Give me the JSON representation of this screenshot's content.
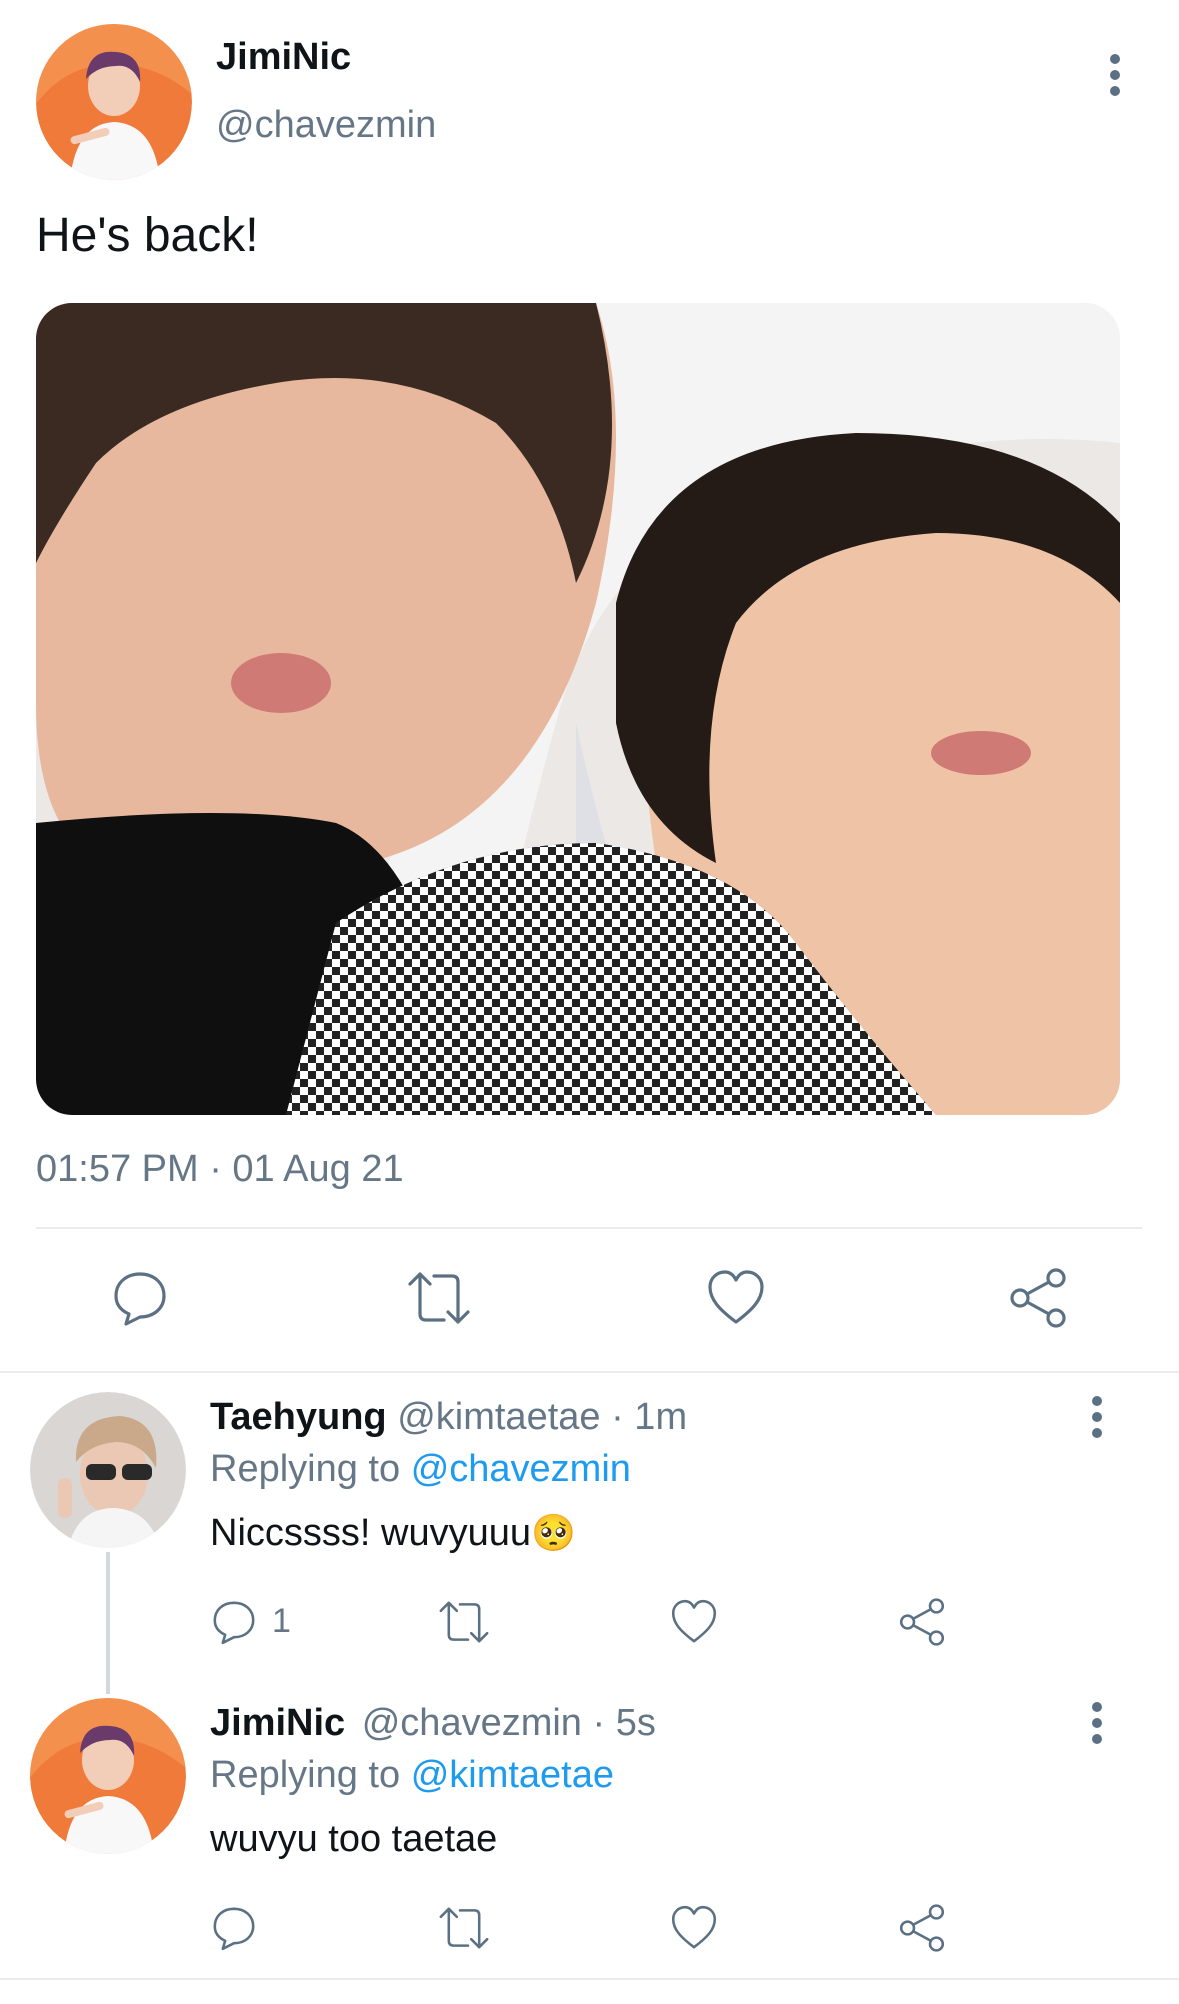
{
  "main_tweet": {
    "display_name": "JimiNic",
    "handle": "@chavezmin",
    "text": "He's back!",
    "timestamp": "01:57 PM · 01 Aug 21",
    "avatar_color": "#f07a3a",
    "actions": [
      "reply-icon",
      "retweet-icon",
      "like-icon",
      "share-icon"
    ]
  },
  "replies": [
    {
      "display_name": "Taehyung",
      "handle": "@kimtaetae",
      "time": "· 1m",
      "replying_label": "Replying to",
      "replying_to": "@chavezmin",
      "text": "Niccssss! wuvyuuu",
      "emoji": "🥺",
      "reply_count": "1"
    },
    {
      "display_name": "JimiNic",
      "handle": "@chavezmin",
      "time": "· 5s",
      "replying_label": "Replying to",
      "replying_to": "@kimtaetae",
      "text": "wuvyu too taetae",
      "reply_count": ""
    }
  ],
  "colors": {
    "text": "#0f1419",
    "muted": "#657786",
    "link": "#1d9bf0",
    "icon": "#5b7083"
  }
}
